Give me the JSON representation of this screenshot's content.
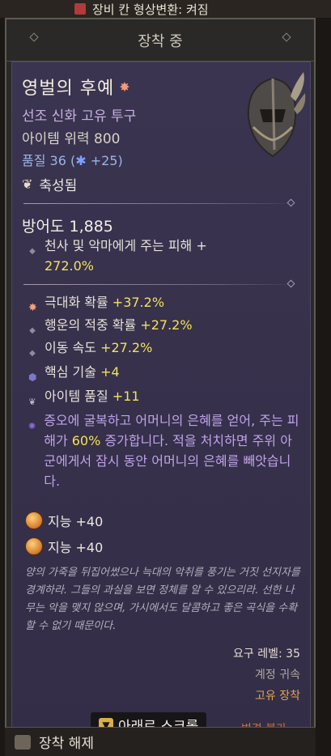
{
  "top_bar": {
    "text": "장비 칸 형상변환: 켜짐"
  },
  "header": {
    "title": "장착 중"
  },
  "item": {
    "name": "영벌의 후예",
    "name_icon": "sparkle-icon",
    "subtitle": "선조 신화 고유 투구",
    "item_power": "아이템 위력 800",
    "quality_label": "품질 36 (",
    "quality_star": "✱",
    "quality_bonus": " +25)",
    "sanctified": "축성됨",
    "armor": "방어도 1,885",
    "implicit": {
      "text": "천사 및 악마에게 주는 피해 +",
      "value": "272.0%"
    },
    "affixes": [
      {
        "label": "극대화 확률 ",
        "value": "+37.2%",
        "icon": "sparkle-icon"
      },
      {
        "label": "행운의 적중 확률 ",
        "value": "+27.2%",
        "icon": "diamond-icon"
      },
      {
        "label": "이동 속도 ",
        "value": "+27.2%",
        "icon": "diamond-icon"
      },
      {
        "label": "핵심 기술 ",
        "value": "+4",
        "icon": "hex-icon"
      },
      {
        "label": "아이템 품질 ",
        "value": "+11",
        "icon": "wing-icon"
      }
    ],
    "unique_power": {
      "part1": "증오에 굴복하고 어머니의 은혜를 얻어, 주는 피해가 ",
      "value": "60%",
      "part2": " 증가합니다. 적을 처치하면 주위 아군에게서 잠시 동안 어머니의 은혜를 빼앗습니다."
    },
    "gems": [
      {
        "label": "지능 +40"
      },
      {
        "label": "지능 +40"
      }
    ],
    "flavor": "양의 가죽을 뒤집어썼으나 늑대의 악취를 풍기는 거짓 선지자를 경계하라. 그들의 과실을 보면 정체를 알 수 있으리라. 선한 나무는 악을 맺지 않으며, 가시에서도 달콤하고 좋은 곡식을 수확할 수 없기 때문이다.",
    "required_level": "요구 레벨: 35",
    "account_bound": "계정 귀속",
    "unique_equipped": "고유 장착",
    "no_change": "변경 불가"
  },
  "scroll_hint": "아래로 스크롤",
  "footer": {
    "unequip": "장착 해제"
  },
  "colors": {
    "affix_value": "#f2e25a",
    "unique_title": "#f2ece0",
    "panel_bg": "#3a3450"
  }
}
